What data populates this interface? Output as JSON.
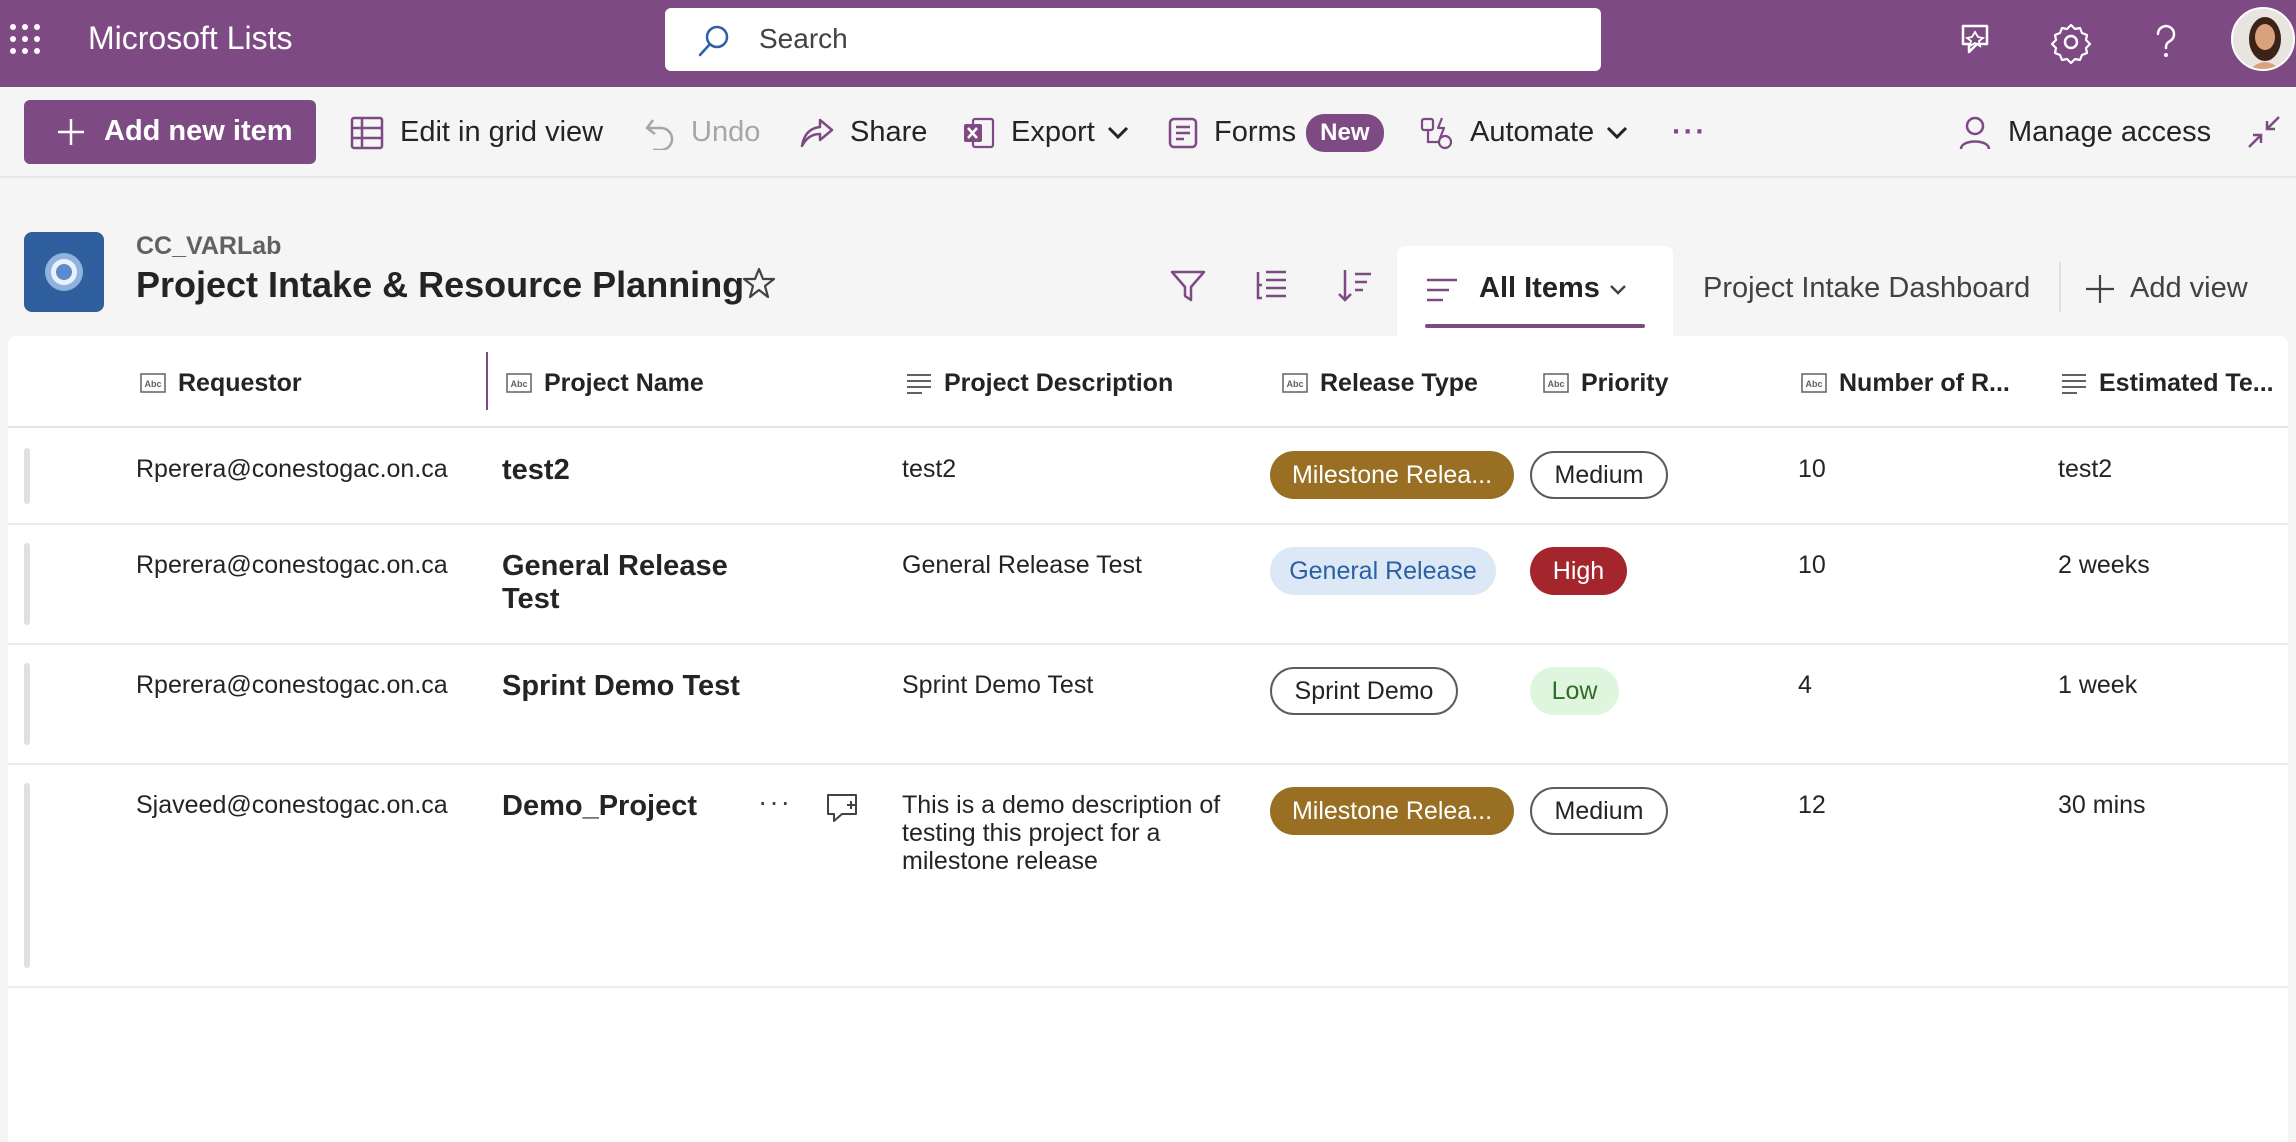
{
  "app": {
    "title": "Microsoft Lists"
  },
  "search": {
    "placeholder": "Search"
  },
  "toolbar": {
    "add_new_item": "Add new item",
    "edit_grid": "Edit in grid view",
    "undo": "Undo",
    "share": "Share",
    "export": "Export",
    "forms": "Forms",
    "forms_badge": "New",
    "automate": "Automate",
    "more": "···",
    "manage_access": "Manage access"
  },
  "list": {
    "site": "CC_VARLab",
    "title": "Project Intake & Resource Planning"
  },
  "views": {
    "current": "All Items",
    "other": "Project Intake Dashboard",
    "add_view": "Add view"
  },
  "columns": [
    "Requestor",
    "Project Name",
    "Project Description",
    "Release Type",
    "Priority",
    "Number of R...",
    "Estimated Te..."
  ],
  "rows": [
    {
      "requestor": "Rperera@conestogac.on.ca",
      "project_name": "test2",
      "description": "test2",
      "release_type": "Milestone Relea...",
      "priority": "Medium",
      "number": "10",
      "estimated": "test2"
    },
    {
      "requestor": "Rperera@conestogac.on.ca",
      "project_name": "General Release Test",
      "description": "General Release Test",
      "release_type": "General Release",
      "priority": "High",
      "number": "10",
      "estimated": "2 weeks"
    },
    {
      "requestor": "Rperera@conestogac.on.ca",
      "project_name": "Sprint Demo Test",
      "description": "Sprint Demo Test",
      "release_type": "Sprint Demo",
      "priority": "Low",
      "number": "4",
      "estimated": "1 week"
    },
    {
      "requestor": "Sjaveed@conestogac.on.ca",
      "project_name": "Demo_Project",
      "description": "This is a demo description of testing this project for a milestone release",
      "release_type": "Milestone Relea...",
      "priority": "Medium",
      "number": "12",
      "estimated": "30 mins"
    }
  ],
  "row_actions": {
    "more": "···"
  },
  "colors": {
    "brand": "#7d4a84",
    "milestone": "#986f23",
    "general_release_bg": "#dce8f5",
    "high": "#a4262c",
    "low_bg": "#dff5dd"
  },
  "icons": [
    "app-launcher-icon",
    "search-icon",
    "feedback-icon",
    "settings-icon",
    "help-icon",
    "plus-icon",
    "grid-icon",
    "undo-icon",
    "share-icon",
    "excel-icon",
    "chevron-down-icon",
    "forms-icon",
    "automate-icon",
    "person-icon",
    "collapse-icon",
    "list-app-icon",
    "star-icon",
    "filter-icon",
    "group-by-icon",
    "sort-icon",
    "view-lines-icon",
    "text-column-icon",
    "multiline-column-icon",
    "comment-icon"
  ]
}
